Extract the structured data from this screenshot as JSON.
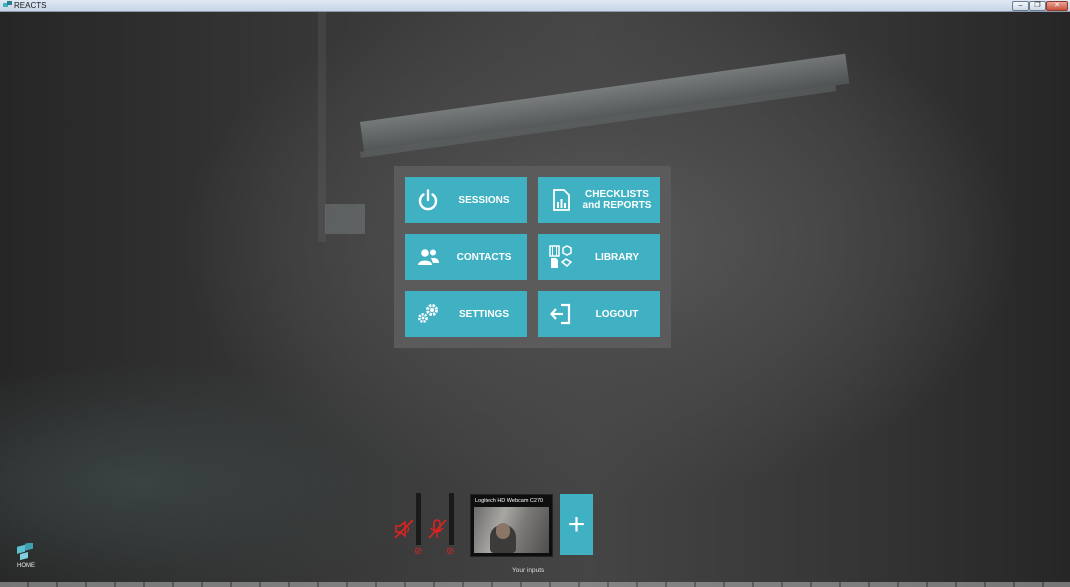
{
  "window": {
    "title": "REACTS",
    "min_glyph": "–",
    "max_glyph": "❐",
    "close_glyph": "✕"
  },
  "menu": {
    "tiles": [
      {
        "id": "sessions",
        "label": "SESSIONS",
        "icon": "power-icon"
      },
      {
        "id": "checklists",
        "label_line1": "CHECKLISTS",
        "label_line2": "and REPORTS",
        "icon": "report-icon"
      },
      {
        "id": "contacts",
        "label": "CONTACTS",
        "icon": "people-icon"
      },
      {
        "id": "library",
        "label": "LIBRARY",
        "icon": "media-library-icon"
      },
      {
        "id": "settings",
        "label": "SETTINGS",
        "icon": "gears-icon"
      },
      {
        "id": "logout",
        "label": "LOGOUT",
        "icon": "logout-icon"
      }
    ]
  },
  "inputs": {
    "webcam_caption": "Logitech HD Webcam C270",
    "label": "Your inputs",
    "speaker_status": "muted",
    "mic_status": "muted",
    "ban_glyph": "⊘",
    "add_glyph": "+"
  },
  "home": {
    "label": "HOME"
  },
  "colors": {
    "accent": "#3fb1c2",
    "panel": "#5b5b5b",
    "muted": "#dd2222"
  }
}
